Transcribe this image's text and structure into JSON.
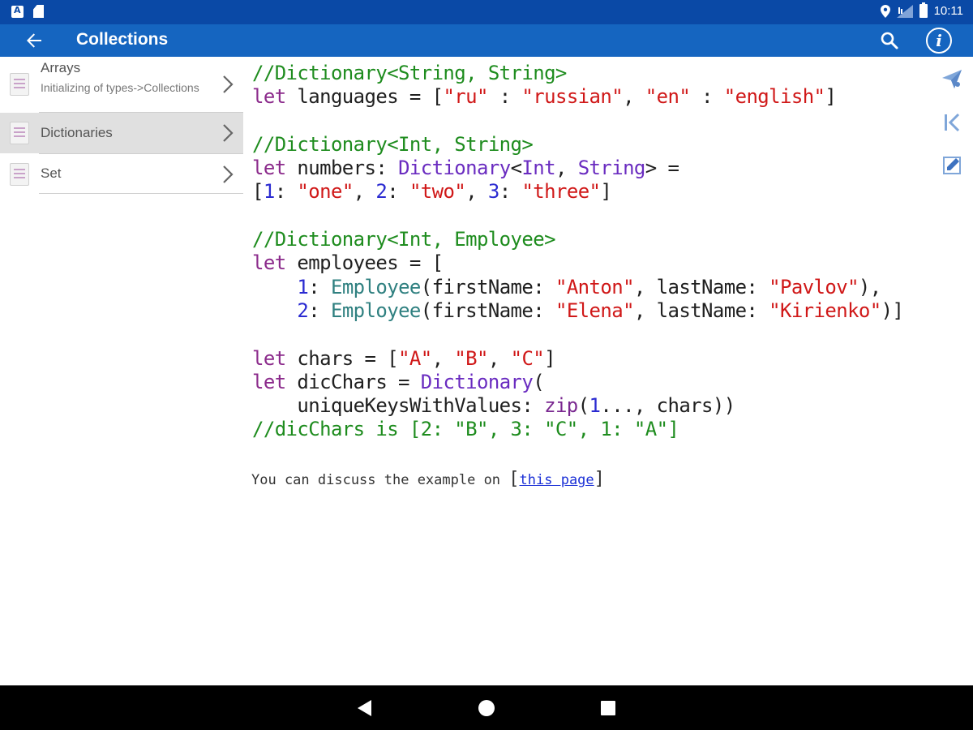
{
  "status_bar": {
    "time": "10:11"
  },
  "app_bar": {
    "title": "Collections"
  },
  "sidebar": {
    "items": [
      {
        "title": "Arrays",
        "subtitle": "Initializing of types->Collections",
        "selected": false
      },
      {
        "title": "Dictionaries",
        "subtitle": "",
        "selected": true
      },
      {
        "title": "Set",
        "subtitle": "",
        "selected": false
      }
    ]
  },
  "code": {
    "c1": "//Dictionary<String, String>",
    "l2_let": "let",
    "l2_a": " languages = [",
    "l2_s1": "\"ru\"",
    "l2_b": " : ",
    "l2_s2": "\"russian\"",
    "l2_c": ", ",
    "l2_s3": "\"en\"",
    "l2_d": " : ",
    "l2_s4": "\"english\"",
    "l2_e": "]",
    "c2": "//Dictionary<Int, String>",
    "l4_let": "let",
    "l4_a": " numbers: ",
    "l4_t1": "Dictionary",
    "l4_b": "<",
    "l4_t2": "Int",
    "l4_c": ", ",
    "l4_t3": "String",
    "l4_d": "> =",
    "l5_a": "[",
    "l5_n1": "1",
    "l5_b": ": ",
    "l5_s1": "\"one\"",
    "l5_c": ", ",
    "l5_n2": "2",
    "l5_d": ": ",
    "l5_s2": "\"two\"",
    "l5_e": ", ",
    "l5_n3": "3",
    "l5_f": ": ",
    "l5_s3": "\"three\"",
    "l5_g": "]",
    "c3": "//Dictionary<Int, Employee>",
    "l7_let": "let",
    "l7_a": " employees = [",
    "l8_ind": "    ",
    "l8_n": "1",
    "l8_a": ": ",
    "l8_cls": "Employee",
    "l8_b": "(firstName: ",
    "l8_s1": "\"Anton\"",
    "l8_c": ", lastName: ",
    "l8_s2": "\"Pavlov\"",
    "l8_d": "),",
    "l9_ind": "    ",
    "l9_n": "2",
    "l9_a": ": ",
    "l9_cls": "Employee",
    "l9_b": "(firstName: ",
    "l9_s1": "\"Elena\"",
    "l9_c": ", lastName: ",
    "l9_s2": "\"Kirienko\"",
    "l9_d": ")]",
    "l11_let": "let",
    "l11_a": " chars = [",
    "l11_s1": "\"A\"",
    "l11_b": ", ",
    "l11_s2": "\"B\"",
    "l11_c": ", ",
    "l11_s3": "\"C\"",
    "l11_d": "]",
    "l12_let": "let",
    "l12_a": " dicChars = ",
    "l12_t": "Dictionary",
    "l12_b": "(",
    "l13_a": "    uniqueKeysWithValues: ",
    "l13_fn": "zip",
    "l13_b": "(",
    "l13_n": "1",
    "l13_c": "..., chars))",
    "c4": "//dicChars is [2: \"B\", 3: \"C\", 1: \"A\"]"
  },
  "discussion": {
    "prefix": "You can discuss the example on ",
    "open_bracket": "[",
    "link_text": "this page",
    "close_bracket": "]"
  },
  "actions": [
    {
      "icon": "send-icon"
    },
    {
      "icon": "first-page-icon"
    },
    {
      "icon": "edit-icon"
    }
  ],
  "colors": {
    "status_bar": "#0a49a6",
    "app_bar": "#1565c0",
    "comment": "#1e8c1e",
    "keyword": "#8b2a8b",
    "string": "#d01818",
    "type": "#6a2cc0",
    "number": "#2b2bd1",
    "link": "#1a2fd6"
  }
}
